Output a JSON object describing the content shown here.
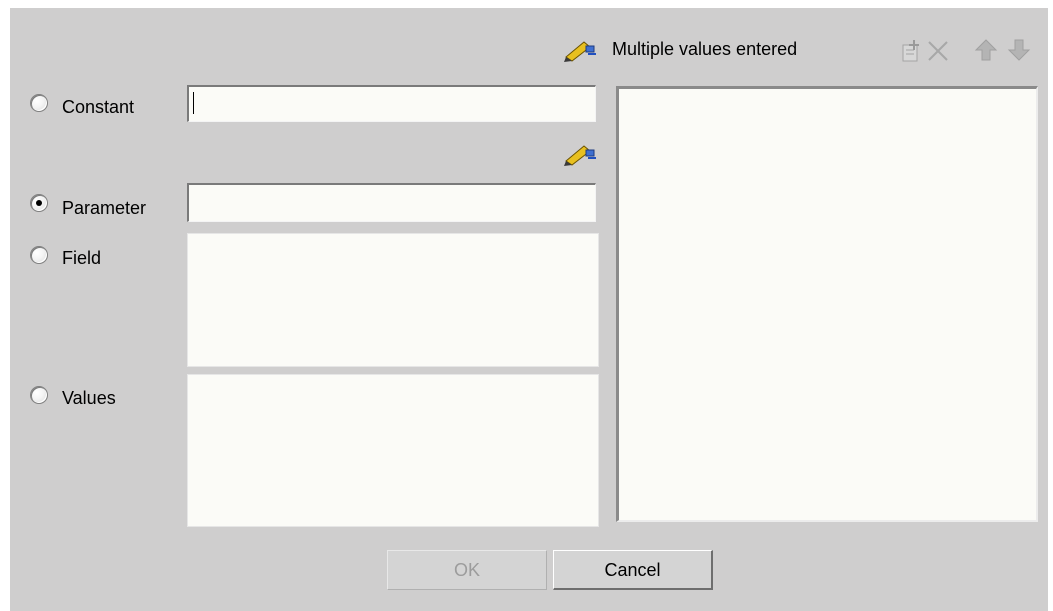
{
  "dialog": {
    "options": {
      "constant": {
        "label": "Constant",
        "selected": false,
        "value": ""
      },
      "parameter": {
        "label": "Parameter",
        "selected": true,
        "value": ""
      },
      "field": {
        "label": "Field",
        "selected": false
      },
      "values": {
        "label": "Values",
        "selected": false
      }
    },
    "multiple_values": {
      "label": "Multiple values entered",
      "items": []
    },
    "toolbar": {
      "icons": [
        "add-icon",
        "delete-icon",
        "move-up-icon",
        "move-down-icon"
      ]
    },
    "buttons": {
      "ok_label": "OK",
      "ok_enabled": false,
      "cancel_label": "Cancel"
    },
    "icons": {
      "edit": "edit-pencil-icon"
    },
    "colors": {
      "background": "#cfcece",
      "field": "#fbfbf7",
      "disabled_text": "#9c9c9c"
    }
  }
}
